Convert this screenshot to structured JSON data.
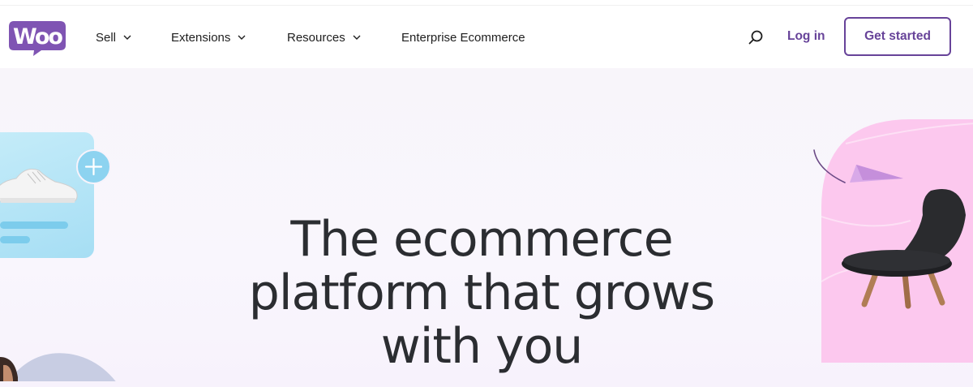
{
  "header": {
    "logo_text": "Woo",
    "nav": [
      {
        "label": "Sell",
        "dropdown": true
      },
      {
        "label": "Extensions",
        "dropdown": true
      },
      {
        "label": "Resources",
        "dropdown": true
      },
      {
        "label": "Enterprise Ecommerce",
        "dropdown": false
      }
    ],
    "search_icon": "search-icon",
    "login_label": "Log in",
    "cta_label": "Get started"
  },
  "hero": {
    "headline_lines": [
      "The ecommerce",
      "platform that grows",
      "with you"
    ]
  },
  "colors": {
    "brand": "#674399",
    "logo": "#7f54b3",
    "text": "#2b2d31",
    "hero_bg": "#f8f5fa",
    "card": "#b5e4f7",
    "arch": "#fbc9ee"
  }
}
